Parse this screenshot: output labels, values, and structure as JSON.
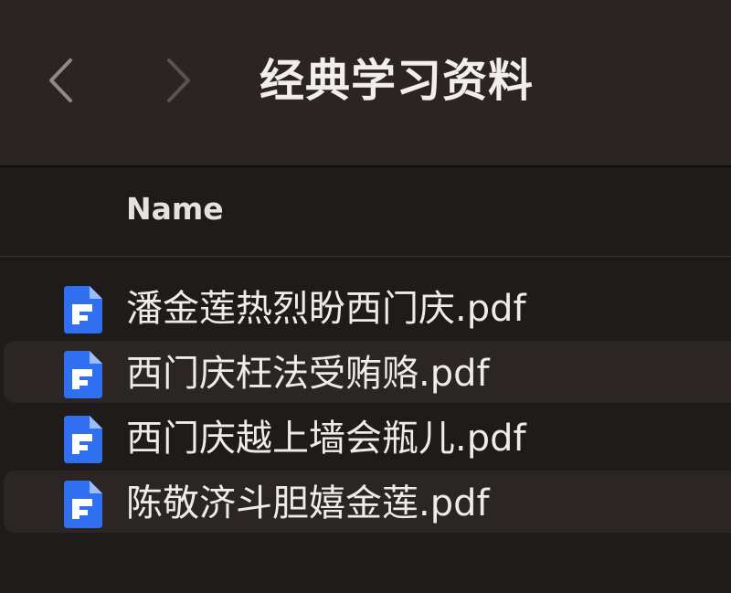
{
  "window": {
    "title": "经典学习资料"
  },
  "toolbar": {
    "back_icon": "chevron-left-icon",
    "forward_icon": "chevron-right-icon"
  },
  "columns": {
    "name": "Name"
  },
  "files": [
    {
      "name": "潘金莲热烈盼西门庆.pdf",
      "icon": "pdf-document-icon"
    },
    {
      "name": "西门庆枉法受贿赂.pdf",
      "icon": "pdf-document-icon"
    },
    {
      "name": "西门庆越上墙会瓶儿.pdf",
      "icon": "pdf-document-icon"
    },
    {
      "name": "陈敬济斗胆嬉金莲.pdf",
      "icon": "pdf-document-icon"
    }
  ],
  "colors": {
    "toolbar_bg": "#2c2424",
    "list_bg": "#201b1b",
    "alt_row_bg": "#2b2525",
    "icon_blue": "#2f6ff0"
  }
}
